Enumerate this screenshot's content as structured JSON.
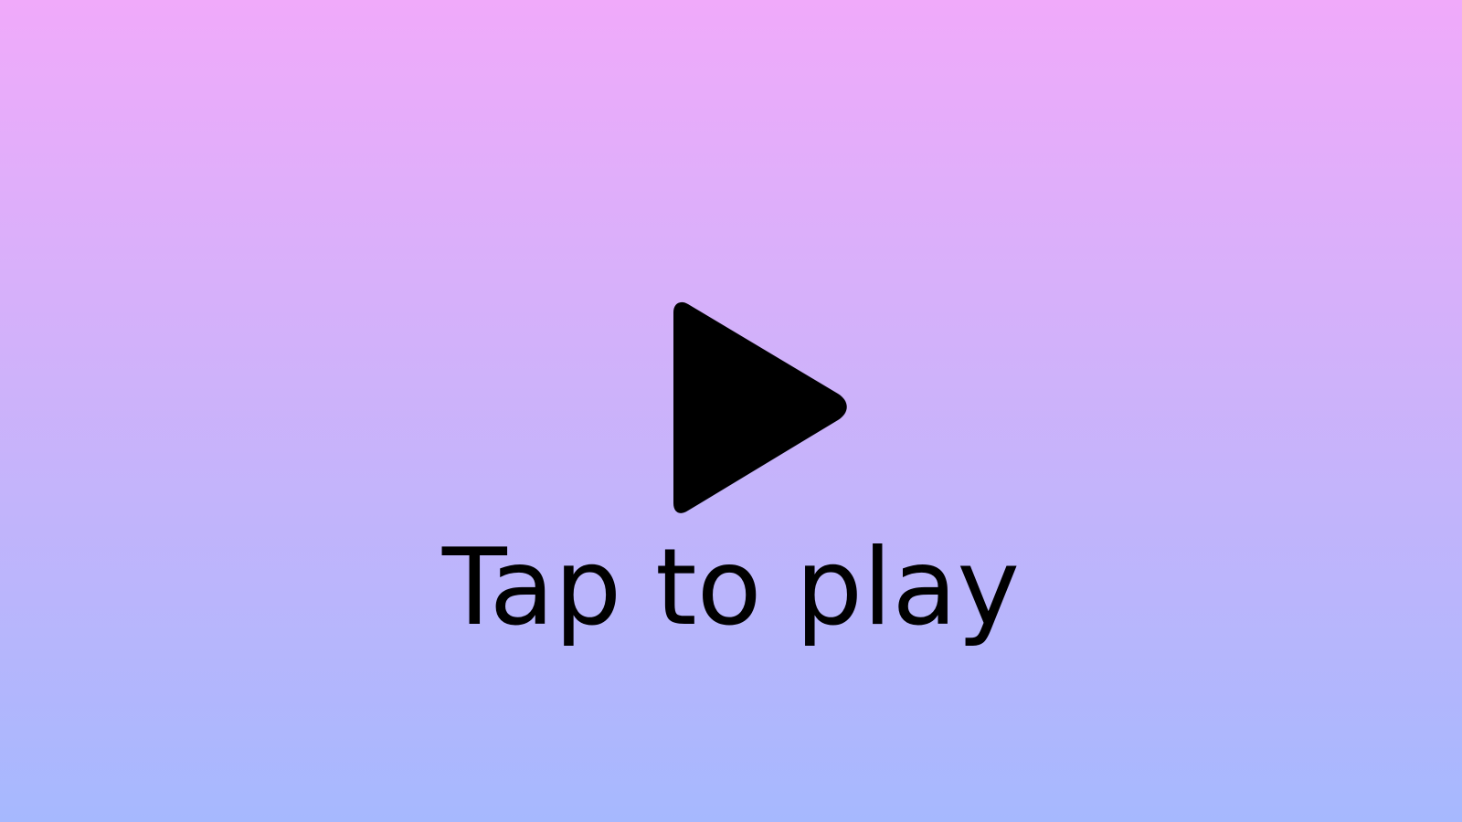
{
  "play_overlay": {
    "label": "Tap to play",
    "icon": "play-icon",
    "colors": {
      "background_top": "#f0aafa",
      "background_bottom": "#a6b8fe",
      "icon": "#000000",
      "text": "#000000"
    }
  }
}
